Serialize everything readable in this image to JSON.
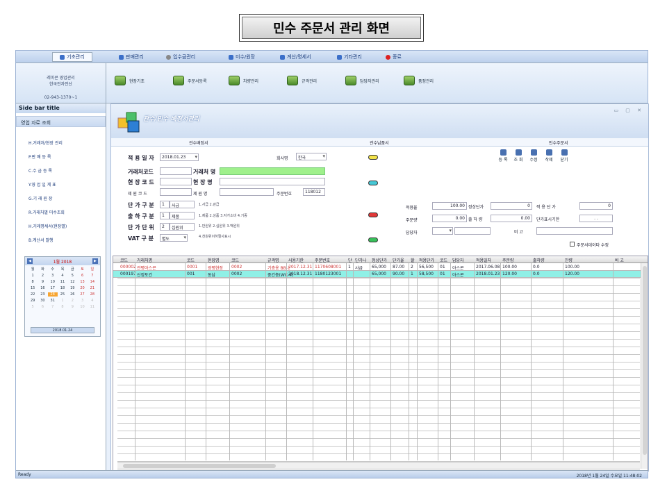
{
  "caption": "민수 주문서 관리 화면",
  "menu": {
    "items": [
      "기초관리",
      "판매관리",
      "입수금관리",
      "미수/원장",
      "계산/명세서",
      "기타관리",
      "종료"
    ]
  },
  "company": {
    "line1": "레미콘 영업관리",
    "line2": "한국전자전산",
    "phone": "02-943-1370~1"
  },
  "toolbar": {
    "items": [
      "현장기초",
      "주문서등록",
      "차량관리",
      "규격관리",
      "담당자관리",
      "품정관리"
    ]
  },
  "sidebar": {
    "title": "Side bar title",
    "group": "영업 자료 조회",
    "items": [
      "H.거래처/현장 관리",
      "P.판 매 등 록",
      "C.수 금 등 록",
      "Y.영 업 일 계 표",
      "G.기 래 원 장",
      "R.거래처별 미수조회",
      "H.거래명세서(현장별)",
      "B.계산서 발행"
    ]
  },
  "calendar": {
    "month": "1월 2018",
    "weekdays": [
      "월",
      "화",
      "수",
      "목",
      "금",
      "토",
      "일"
    ],
    "weeks": [
      [
        "1",
        "2",
        "3",
        "4",
        "5",
        "6",
        "7"
      ],
      [
        "8",
        "9",
        "10",
        "11",
        "12",
        "13",
        "14"
      ],
      [
        "15",
        "16",
        "17",
        "18",
        "19",
        "20",
        "21"
      ],
      [
        "22",
        "23",
        "24",
        "25",
        "26",
        "27",
        "28"
      ],
      [
        "29",
        "30",
        "31",
        "1",
        "2",
        "3",
        "4"
      ],
      [
        "5",
        "6",
        "7",
        "8",
        "9",
        "10",
        "11"
      ]
    ],
    "today": "2018.01.24"
  },
  "main": {
    "title": "관수/민수 배정서관리",
    "window_controls": "▭ ▢ ✕",
    "tabs": [
      "관수배정서",
      "관수납품서",
      "민수주문서"
    ]
  },
  "form": {
    "apply_date_label": "적 용 일 자",
    "apply_date": "2018.01.23",
    "company_label": "회사명",
    "company_value": "한국",
    "client_code_label": "거래처코드",
    "client_name_label": "거래처 명",
    "site_code_label": "현 장 코 드",
    "site_name_label": "현 장 명",
    "spec_code_label": "제 원 코 드",
    "spec_name_label": "제 원 명",
    "order_no_label": "주문번호",
    "order_no": "118012",
    "price_type_label": "단 가 구 분",
    "price_type_code": "1",
    "price_type_value": "사급",
    "price_type_hint": "1.사급 2.관급",
    "ship_type_label": "출 하 구 분",
    "ship_type_code": "1",
    "ship_type_value": "제품",
    "ship_type_hint": "1.제품 2.상품 3.자가소비 4.기증",
    "price_unit_label": "단 가 단 위",
    "price_unit_code": "2",
    "price_unit_value": "십원위",
    "price_unit_hint1": "1.만원위 2.십원위 3.백원위",
    "price_unit_hint2": "4.천원위이하절사표시",
    "vat_label": "VAT 구 분",
    "vat_value": "별도",
    "rate_label": "적용율",
    "rate_value": "100.00",
    "normal_price_label": "정상단가",
    "normal_price_value": "0",
    "apply_price_label": "적 용 단 가",
    "apply_price_value": "0",
    "order_qty_label": "주문량",
    "order_qty_value": "0.00",
    "ship_qty_label": "출 하 량",
    "ship_qty_value": "0.00",
    "price_period_label": "단가표시기한",
    "price_period_value": ". .",
    "manager_label": "담당자",
    "note_label": "비  고",
    "order_edit_label": "주문서데이타 수정",
    "buttons": [
      "등 록",
      "조 회",
      "수정",
      "삭제",
      "닫기"
    ]
  },
  "grid": {
    "headers": [
      "코드",
      "거래처명",
      "코드",
      "현장명",
      "코드",
      "규격명",
      "사용기한",
      "주문번호",
      "단",
      "단가나",
      "정상단가",
      "단가율",
      "할",
      "적용단가",
      "코드",
      "담당자",
      "적용일자",
      "주문량",
      "출하량",
      "잔량",
      "비 고"
    ],
    "rows": [
      [
        "000002",
        "관평아스콘",
        "0001",
        "광평현장",
        "0002",
        "기층용 BB-1",
        "2017.12.31",
        "1170608001",
        "1",
        "사급",
        "65,000",
        "87.00",
        "2",
        "56,500",
        "01",
        "아스콘",
        "2017.06.08",
        "100.00",
        "0.0",
        "100.00",
        ""
      ],
      [
        "000197",
        "신정토건",
        "001",
        "동남",
        "0002",
        "중간층(WC-4)",
        "2018.12.31",
        "1180123001",
        "",
        "",
        "65,000",
        "90.00",
        "1",
        "58,500",
        "01",
        "아스콘",
        "2018.01.23",
        "120.00",
        "0.0",
        "120.00",
        ""
      ]
    ]
  },
  "status": {
    "left": "Ready",
    "right": "2018년 1월 24일 수요일 11:48:02"
  },
  "colors": {
    "accent": "#3b6fc9",
    "selected_row": "#8ff0e6",
    "name_field": "#9ff08c"
  }
}
